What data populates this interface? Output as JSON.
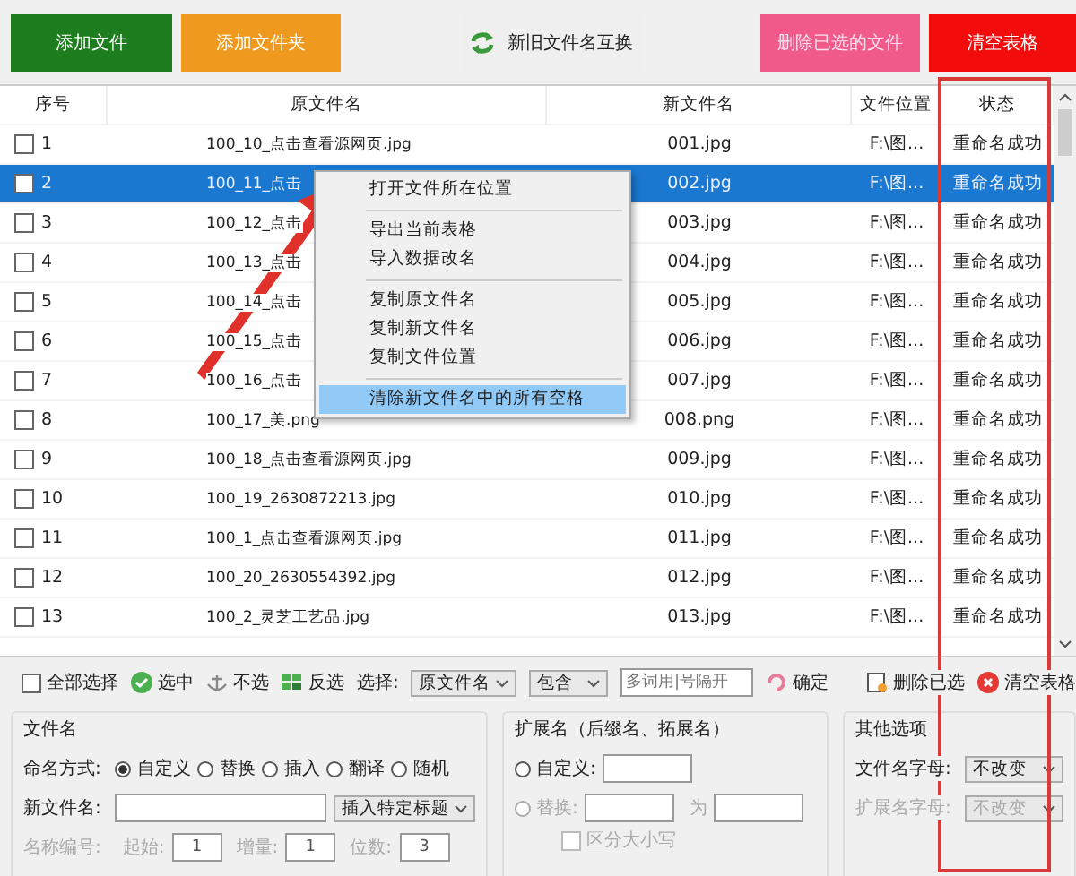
{
  "toolbar": {
    "buttons": [
      {
        "label": "添加文件",
        "kind": "green"
      },
      {
        "label": "添加文件夹",
        "kind": "orange"
      },
      {
        "label": "新旧文件名互换",
        "kind": "swap"
      },
      {
        "label": "删除已选的文件",
        "kind": "pink"
      },
      {
        "label": "清空表格",
        "kind": "red"
      }
    ]
  },
  "table": {
    "columns": [
      "序号",
      "原文件名",
      "新文件名",
      "文件位置",
      "状态"
    ],
    "rows": [
      {
        "index": "1",
        "checked": false,
        "selected": false,
        "original": "100_10_点击查看源网页.jpg",
        "new": "001.jpg",
        "location": "F:\\图...",
        "status": "重命名成功"
      },
      {
        "index": "2",
        "checked": false,
        "selected": true,
        "original": "100_11_点击",
        "new": "002.jpg",
        "location": "F:\\图...",
        "status": "重命名成功"
      },
      {
        "index": "3",
        "checked": false,
        "selected": false,
        "original": "100_12_点击",
        "new": "003.jpg",
        "location": "F:\\图...",
        "status": "重命名成功"
      },
      {
        "index": "4",
        "checked": false,
        "selected": false,
        "original": "100_13_点击",
        "new": "004.jpg",
        "location": "F:\\图...",
        "status": "重命名成功"
      },
      {
        "index": "5",
        "checked": false,
        "selected": false,
        "original": "100_14_点击",
        "new": "005.jpg",
        "location": "F:\\图...",
        "status": "重命名成功"
      },
      {
        "index": "6",
        "checked": false,
        "selected": false,
        "original": "100_15_点击",
        "new": "006.jpg",
        "location": "F:\\图...",
        "status": "重命名成功"
      },
      {
        "index": "7",
        "checked": false,
        "selected": false,
        "original": "100_16_点击",
        "new": "007.jpg",
        "location": "F:\\图...",
        "status": "重命名成功"
      },
      {
        "index": "8",
        "checked": false,
        "selected": false,
        "original": "100_17_美.png",
        "new": "008.png",
        "location": "F:\\图...",
        "status": "重命名成功"
      },
      {
        "index": "9",
        "checked": false,
        "selected": false,
        "original": "100_18_点击查看源网页.jpg",
        "new": "009.jpg",
        "location": "F:\\图...",
        "status": "重命名成功"
      },
      {
        "index": "10",
        "checked": false,
        "selected": false,
        "original": "100_19_2630872213.jpg",
        "new": "010.jpg",
        "location": "F:\\图...",
        "status": "重命名成功"
      },
      {
        "index": "11",
        "checked": false,
        "selected": false,
        "original": "100_1_点击查看源网页.jpg",
        "new": "011.jpg",
        "location": "F:\\图...",
        "status": "重命名成功"
      },
      {
        "index": "12",
        "checked": false,
        "selected": false,
        "original": "100_20_2630554392.jpg",
        "new": "012.jpg",
        "location": "F:\\图...",
        "status": "重命名成功"
      },
      {
        "index": "13",
        "checked": false,
        "selected": false,
        "original": "100_2_灵芝工艺品.jpg",
        "new": "013.jpg",
        "location": "F:\\图...",
        "status": "重命名成功"
      }
    ]
  },
  "context_menu": {
    "sections": [
      {
        "items": [
          {
            "label": "打开文件所在位置",
            "selected": false
          }
        ]
      },
      {
        "items": [
          {
            "label": "导出当前表格",
            "selected": false
          },
          {
            "label": "导入数据改名",
            "selected": false
          }
        ]
      },
      {
        "items": [
          {
            "label": "复制原文件名",
            "selected": false
          },
          {
            "label": "复制新文件名",
            "selected": false
          },
          {
            "label": "复制文件位置",
            "selected": false
          }
        ]
      },
      {
        "items": [
          {
            "label": "清除新文件名中的所有空格",
            "selected": true
          }
        ]
      }
    ]
  },
  "select_bar": {
    "select_all": {
      "label": "全部选择",
      "checked": false
    },
    "actions": [
      {
        "label": "选中",
        "kind": "check"
      },
      {
        "label": "不选",
        "kind": "anchor"
      },
      {
        "label": "反选",
        "kind": "grid"
      }
    ],
    "select_label": "选择:",
    "field_dropdown": "原文件名",
    "match_dropdown": "包含",
    "search": {
      "placeholder": "多词用|号隔开"
    },
    "confirm": "确定",
    "delete_selected": "删除已选",
    "clear_table": "清空表格"
  },
  "filename_panel": {
    "title": "文件名",
    "mode_label": "命名方式:",
    "modes": [
      {
        "label": "自定义",
        "selected": true
      },
      {
        "label": "替换",
        "selected": false
      },
      {
        "label": "插入",
        "selected": false
      },
      {
        "label": "翻译",
        "selected": false
      },
      {
        "label": "随机",
        "selected": false
      }
    ],
    "new_name_label": "新文件名:",
    "insert_dropdown": "插入特定标题",
    "numbering": {
      "label": "名称编号:",
      "disabled": true,
      "fields": [
        {
          "label": "起始:",
          "value": "1"
        },
        {
          "label": "增量:",
          "value": "1"
        },
        {
          "label": "位数:",
          "value": "3"
        }
      ]
    }
  },
  "extension_panel": {
    "title": "扩展名（后缀名、拓展名）",
    "custom": {
      "label": "自定义:",
      "selected": false
    },
    "replace": {
      "label": "替换:",
      "selected": false,
      "disabled": true,
      "to_label": "为"
    },
    "case_sensitive": {
      "label": "区分大小写",
      "checked": false,
      "disabled": true
    }
  },
  "other_panel": {
    "title": "其他选项",
    "options": [
      {
        "label": "文件名字母:",
        "value": "不改变",
        "disabled": false
      },
      {
        "label": "扩展名字母:",
        "value": "不改变",
        "disabled": true
      }
    ]
  }
}
